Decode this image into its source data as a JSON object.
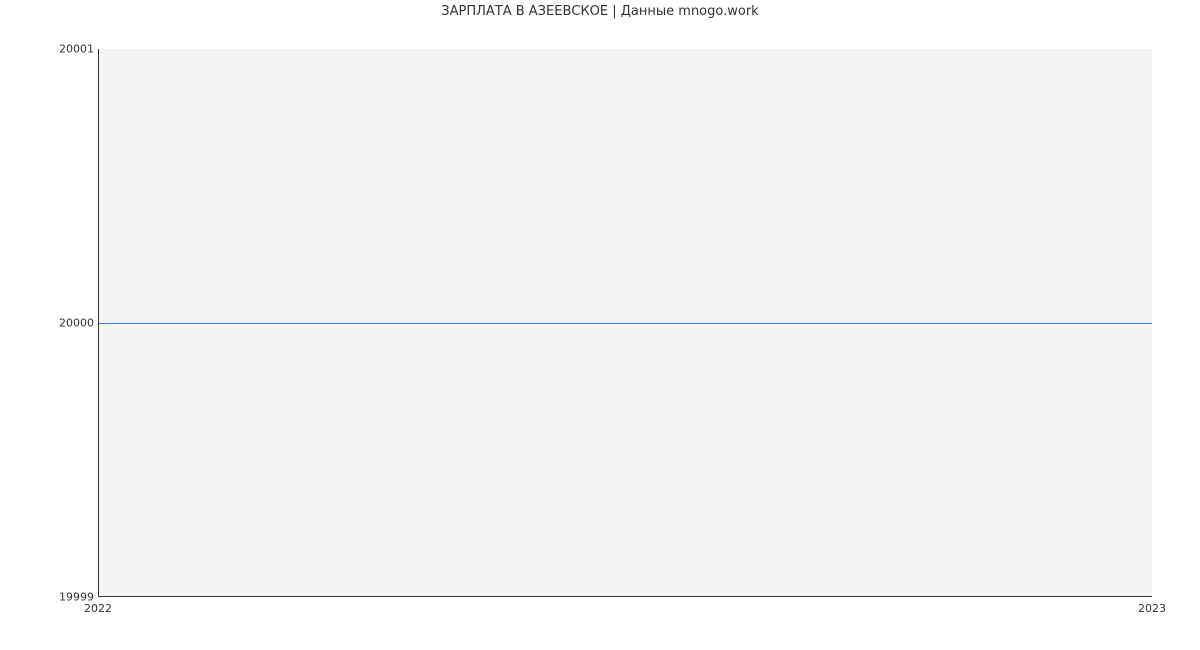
{
  "chart_data": {
    "type": "line",
    "title": "ЗАРПЛАТА В АЗЕЕВСКОЕ | Данные mnogo.work",
    "xlabel": "",
    "ylabel": "",
    "x": [
      "2022",
      "2023"
    ],
    "values": [
      20000,
      20000
    ],
    "ylim": [
      19999,
      20001
    ],
    "yticks": [
      19999,
      20000,
      20001
    ],
    "xticks": [
      "2022",
      "2023"
    ],
    "line_color": "#3b7dd8",
    "grid_color": "#ffffff",
    "plot_bg": "#f4f4f4"
  },
  "labels": {
    "title": "ЗАРПЛАТА В АЗЕЕВСКОЕ | Данные mnogo.work",
    "ytick_top": "20001",
    "ytick_mid": "20000",
    "ytick_bot": "19999",
    "xtick_left": "2022",
    "xtick_right": "2023"
  }
}
